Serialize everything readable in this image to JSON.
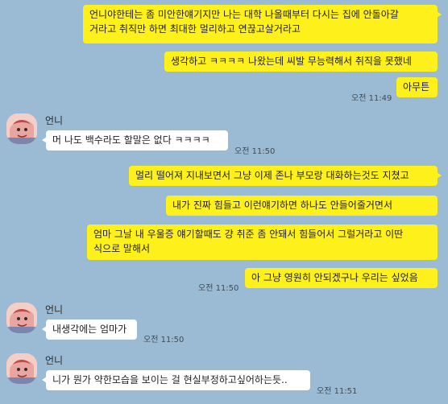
{
  "chat": {
    "messages": [
      {
        "side": "me",
        "lines": [
          "언니야한테는 좀 미안한얘기지만 나는 대학 나올때부터 다시는 집에 안돌아갈",
          "거라고 취직만 하면 최대한 멀리하고 연끊고살거라고"
        ]
      },
      {
        "side": "me",
        "lines": [
          "생각하고 ㅋㅋㅋㅋ 나왔는데 씨발 무능력해서 취직을 못했네"
        ]
      },
      {
        "side": "me",
        "lines": [
          "아무튼"
        ],
        "time": "오전 11:49"
      },
      {
        "side": "other",
        "name": "언니",
        "lines": [
          "머 나도 백수라도 할말은 없다 ㅋㅋㅋㅋ"
        ],
        "time": "오전 11:50"
      },
      {
        "side": "me",
        "lines": [
          "멀리 떨어져 지내보면서 그냥 이제 존나 부모랑 대화하는것도 지쳤고"
        ]
      },
      {
        "side": "me",
        "lines": [
          "내가 진짜 힘들고 이런얘기하면 하나도 안들어줄거면서"
        ]
      },
      {
        "side": "me",
        "lines": [
          "엄마 그날 내 우울증 얘기할때도 걍 취준 좀 안돼서 힘들어서 그럴거라고 이딴",
          "식으로 말해서"
        ]
      },
      {
        "side": "me",
        "lines": [
          "아 그냥 영원히 안되겠구나 우리는 싶었음"
        ],
        "time": "오전 11:50"
      },
      {
        "side": "other",
        "name": "언니",
        "lines": [
          "내생각에는 엄마가"
        ],
        "time": "오전 11:50"
      },
      {
        "side": "other",
        "name": "언니",
        "lines": [
          "니가 뭔가 약한모습을 보이는 걸 현실부정하고싶어하는듯.."
        ],
        "time": "오전 11:51"
      }
    ]
  },
  "colors": {
    "background": "#9bbbd4",
    "my_bubble": "#fef01b",
    "other_bubble": "#ffffff"
  }
}
